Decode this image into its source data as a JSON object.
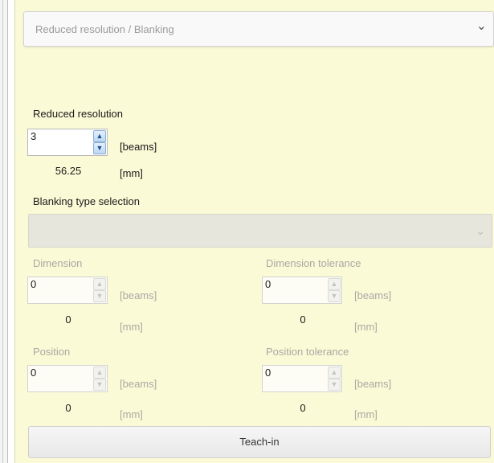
{
  "section": {
    "title": "Reduced resolution / Blanking"
  },
  "reduced_resolution": {
    "label": "Reduced resolution",
    "value": "3",
    "unit_beams": "[beams]",
    "mm_value": "56.25",
    "unit_mm": "[mm]"
  },
  "blanking": {
    "label": "Blanking type selection",
    "selected": ""
  },
  "dimension": {
    "label": "Dimension",
    "value": "0",
    "unit_beams": "[beams]",
    "mm_value": "0",
    "unit_mm": "[mm]"
  },
  "dimension_tolerance": {
    "label": "Dimension tolerance",
    "value": "0",
    "unit_beams": "[beams]",
    "mm_value": "0",
    "unit_mm": "[mm]"
  },
  "position": {
    "label": "Position",
    "value": "0",
    "unit_beams": "[beams]",
    "mm_value": "0",
    "unit_mm": "[mm]"
  },
  "position_tolerance": {
    "label": "Position tolerance",
    "value": "0",
    "unit_beams": "[beams]",
    "mm_value": "0",
    "unit_mm": "[mm]"
  },
  "teach_button": {
    "label": "Teach-in"
  },
  "icons": {
    "header_chevron": "chevron-down-icon",
    "dropdown_chevron": "chevron-down-icon",
    "spin_up": "arrow-up-icon",
    "spin_down": "arrow-down-icon"
  },
  "colors": {
    "panel_background": "#fbfad6",
    "spin_accent": "#1f4f8f",
    "disabled_text": "#a9a9a5"
  }
}
